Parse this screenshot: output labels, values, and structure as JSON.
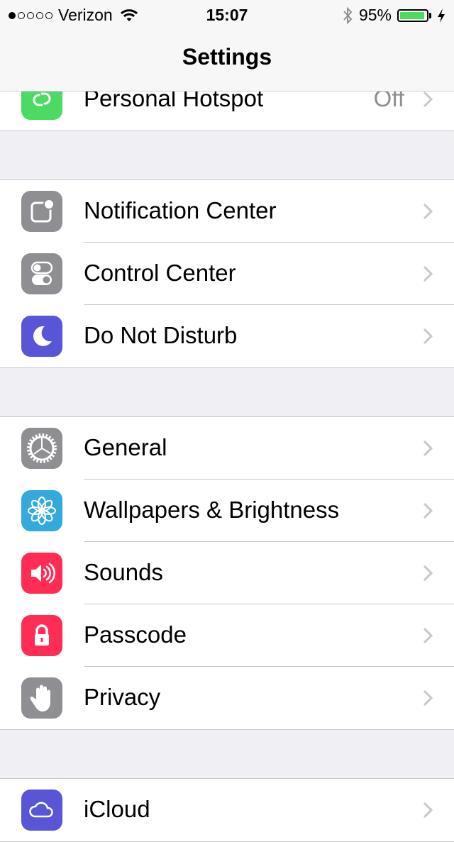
{
  "status": {
    "carrier": "Verizon",
    "time": "15:07",
    "battery_percent": "95%",
    "signal_bars_filled": 1,
    "battery_level": 0.95
  },
  "nav": {
    "title": "Settings"
  },
  "colors": {
    "green": "#4cd964",
    "gray": "#8e8e93",
    "purple": "#5856d6",
    "blue": "#34aadc",
    "red": "#ff2d55"
  },
  "groups": [
    {
      "rows": [
        {
          "label": "Personal Hotspot",
          "value": "Off",
          "icon": "hotspot-icon"
        }
      ]
    },
    {
      "rows": [
        {
          "label": "Notification Center",
          "icon": "notification-center-icon"
        },
        {
          "label": "Control Center",
          "icon": "control-center-icon"
        },
        {
          "label": "Do Not Disturb",
          "icon": "moon-icon"
        }
      ]
    },
    {
      "rows": [
        {
          "label": "General",
          "icon": "gear-icon"
        },
        {
          "label": "Wallpapers & Brightness",
          "icon": "flower-icon"
        },
        {
          "label": "Sounds",
          "icon": "speaker-icon"
        },
        {
          "label": "Passcode",
          "icon": "lock-icon"
        },
        {
          "label": "Privacy",
          "icon": "hand-icon"
        }
      ]
    },
    {
      "rows": [
        {
          "label": "iCloud",
          "icon": "cloud-icon"
        }
      ]
    }
  ]
}
